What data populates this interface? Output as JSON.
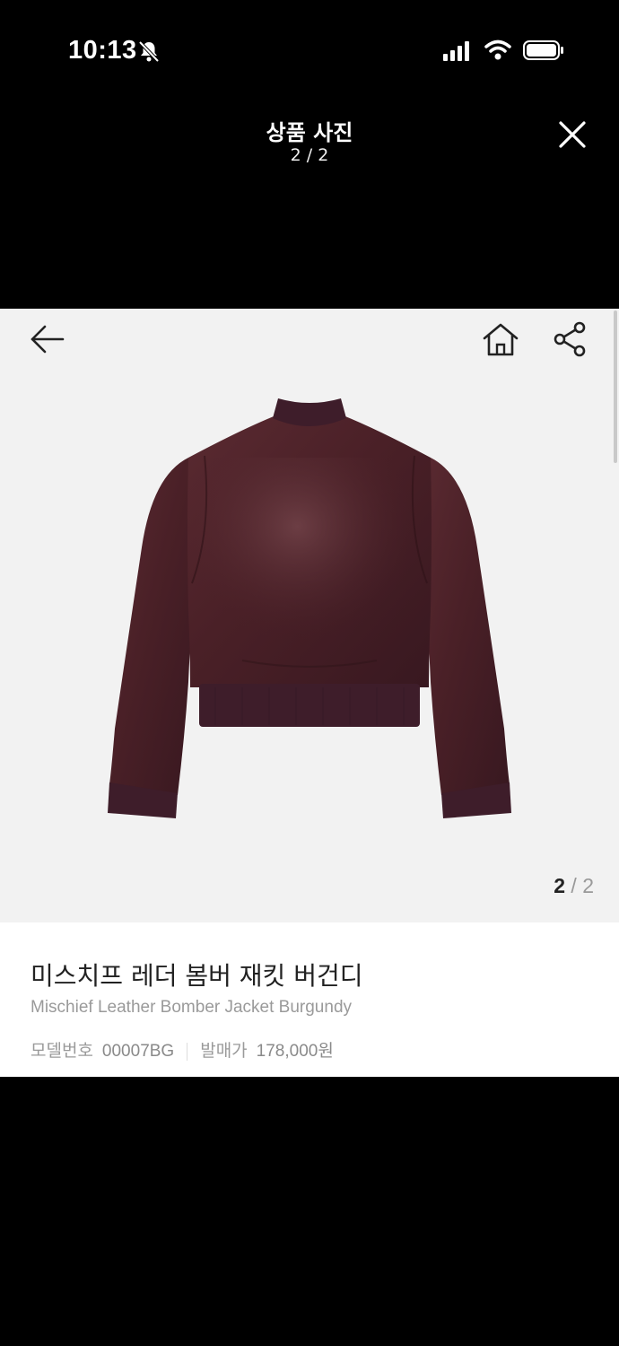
{
  "status_bar": {
    "time": "10:13"
  },
  "viewer": {
    "title": "상품 사진",
    "counter": "2 / 2"
  },
  "product": {
    "name_ko": "미스치프 레더 봄버 재킷 버건디",
    "name_en": "Mischief Leather Bomber Jacket Burgundy",
    "model_label": "모델번호",
    "model_value": "00007BG",
    "price_label": "발매가",
    "price_value": "178,000원"
  },
  "gallery": {
    "current": "2",
    "separator": "/",
    "total": "2"
  },
  "icons": {
    "close": "close-icon",
    "back": "back-arrow-icon",
    "home": "home-icon",
    "share": "share-icon",
    "bell": "bell-slash-icon"
  },
  "colors": {
    "jacket": "#4a2027",
    "rib": "#3e1d2a"
  }
}
